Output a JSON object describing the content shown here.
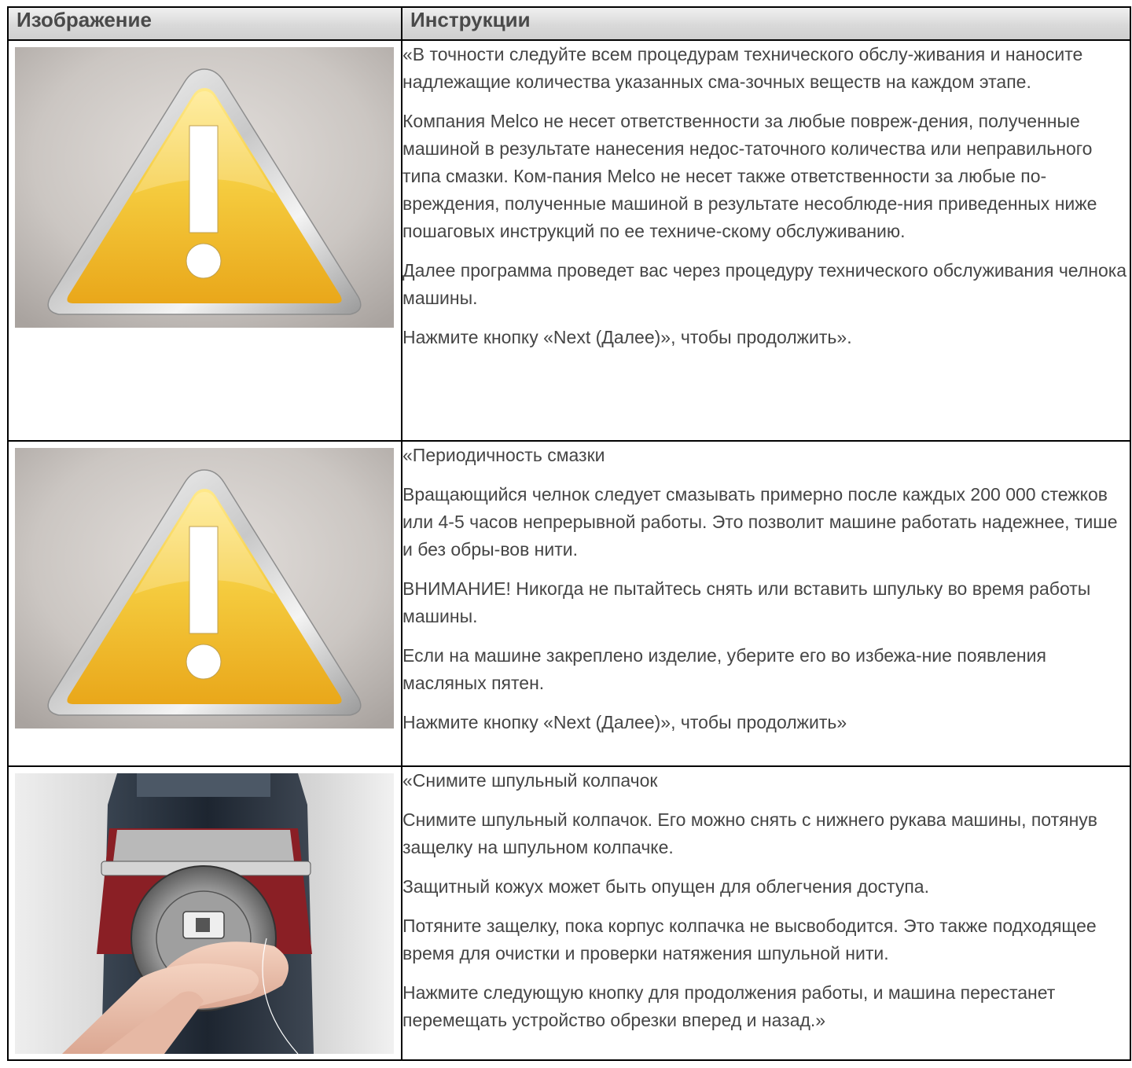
{
  "table": {
    "header": {
      "image_col": "Изображение",
      "instructions_col": "Инструкции"
    },
    "rows": [
      {
        "image": "warning-triangle",
        "paragraphs": [
          "«В точности следуйте всем процедурам технического обслу-живания и наносите надлежащие количества указанных сма-зочных веществ на каждом этапе.",
          "Компания Melco не несет ответственности за любые повреж-дения, полученные машиной в результате нанесения недос-таточного количества или неправильного типа смазки. Ком-пания Melco не несет также ответственности за любые по-вреждения, полученные машиной в результате несоблюде-ния приведенных ниже пошаговых инструкций по ее техниче-скому обслуживанию.",
          "Далее программа проведет вас через процедуру технического обслуживания челнока машины.",
          "Нажмите кнопку «Next (Далее)», чтобы продолжить»."
        ]
      },
      {
        "image": "warning-triangle",
        "paragraphs": [
          "«Периодичность смазки",
          "Вращающийся челнок следует смазывать примерно после каждых 200 000 стежков или 4-5 часов непрерывной работы. Это позволит машине работать надежнее, тише и без обры-вов нити.",
          "ВНИМАНИЕ! Никогда не пытайтесь снять или вставить шпульку во время работы машины.",
          "Если на машине закреплено изделие, уберите его во избежа-ние появления масляных пятен.",
          "Нажмите кнопку «Next (Далее)», чтобы продолжить»"
        ]
      },
      {
        "image": "bobbin-case-photo",
        "paragraphs": [
          "«Снимите шпульный колпачок",
          "Снимите шпульный колпачок. Его можно снять с нижнего рукава машины, потянув защелку на шпульном колпачке.",
          "Защитный кожух может быть опущен для облегчения доступа.",
          "Потяните защелку, пока корпус колпачка не высвободится. Это также подходящее время для очистки и проверки натяжения шпульной нити.",
          "Нажмите следующую кнопку для продолжения работы, и машина перестанет перемещать устройство обрезки вперед и назад.»"
        ]
      }
    ]
  }
}
